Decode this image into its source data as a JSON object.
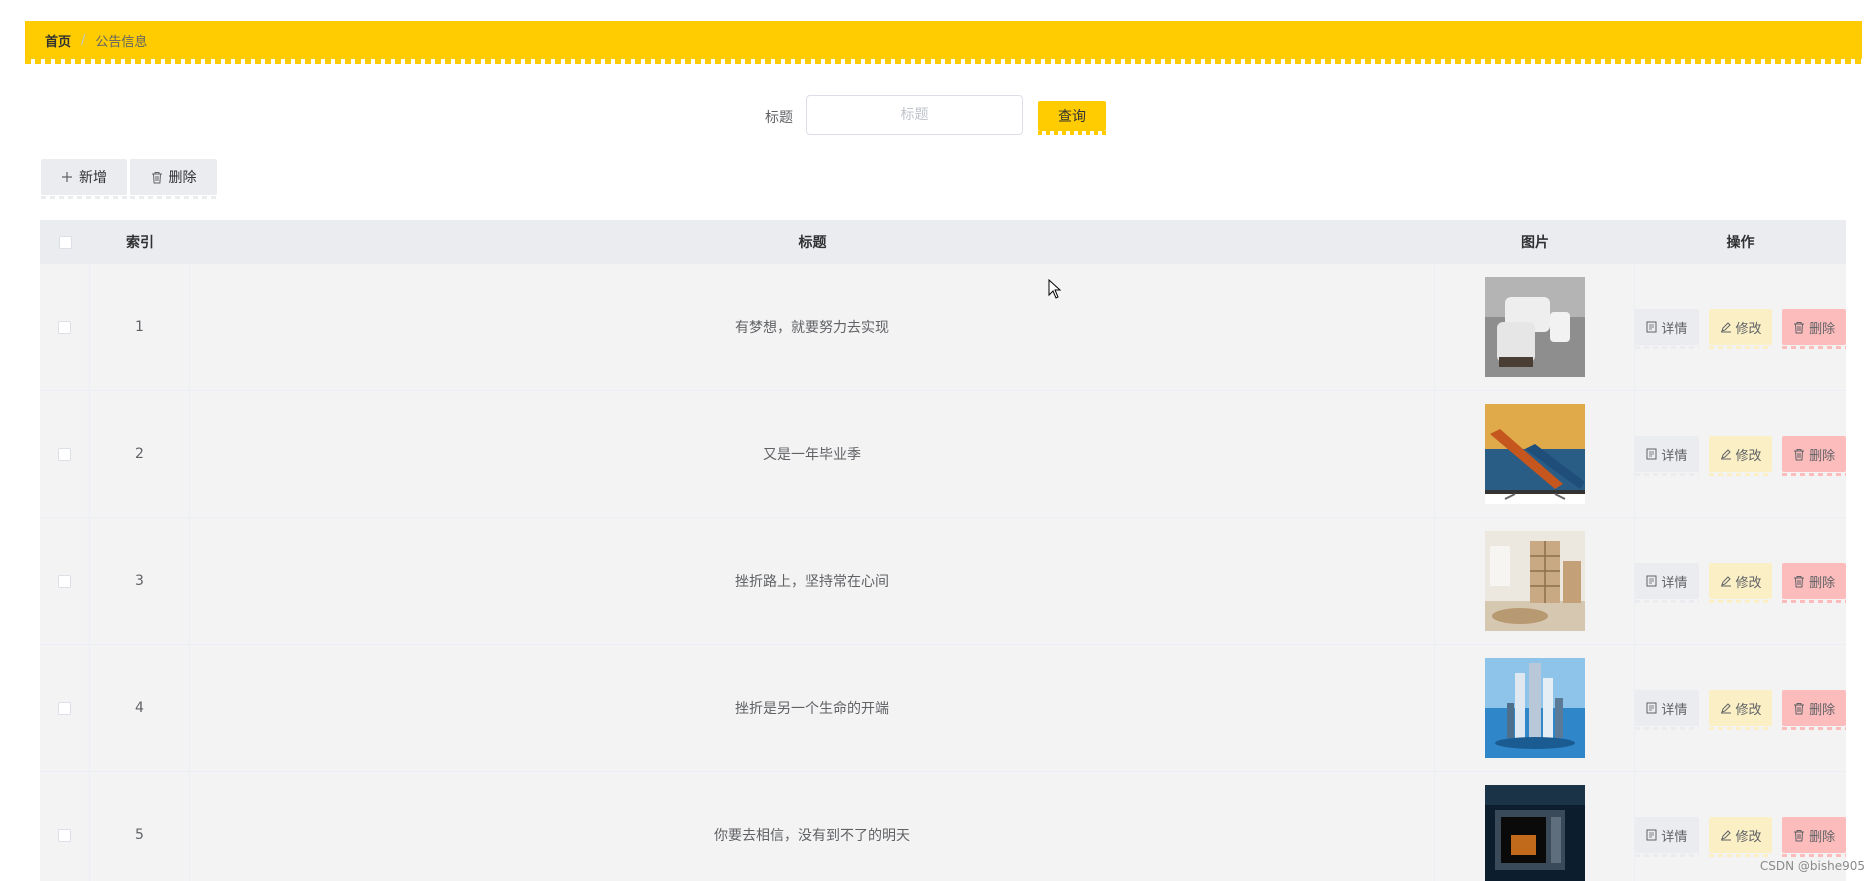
{
  "breadcrumb": {
    "home": "首页",
    "separator": "/",
    "current": "公告信息"
  },
  "search": {
    "label": "标题",
    "placeholder": "标题",
    "value": "",
    "button": "查询"
  },
  "toolbar": {
    "add_label": "新增",
    "delete_label": "删除"
  },
  "table": {
    "headers": {
      "index": "索引",
      "title": "标题",
      "image": "图片",
      "actions": "操作"
    },
    "rows": [
      {
        "index": "1",
        "title": "有梦想，就要努力去实现",
        "image": "sofa-photo"
      },
      {
        "index": "2",
        "title": "又是一年毕业季",
        "image": "kayak-tv-photo"
      },
      {
        "index": "3",
        "title": "挫折路上，坚持常在心间",
        "image": "bookshelf-room-photo"
      },
      {
        "index": "4",
        "title": "挫折是另一个生命的开端",
        "image": "blue-bottles-photo"
      },
      {
        "index": "5",
        "title": "你要去相信，没有到不了的明天",
        "image": "microwave-photo"
      }
    ],
    "actions": {
      "detail": "详情",
      "edit": "修改",
      "delete": "删除"
    }
  },
  "colors": {
    "accent": "#fecc00",
    "header_bg": "#ebecef",
    "row_bg": "#f3f3f3",
    "edit_bg": "#faefc5",
    "delete_bg": "#fcbcbc"
  },
  "watermark": "CSDN @bishe905"
}
